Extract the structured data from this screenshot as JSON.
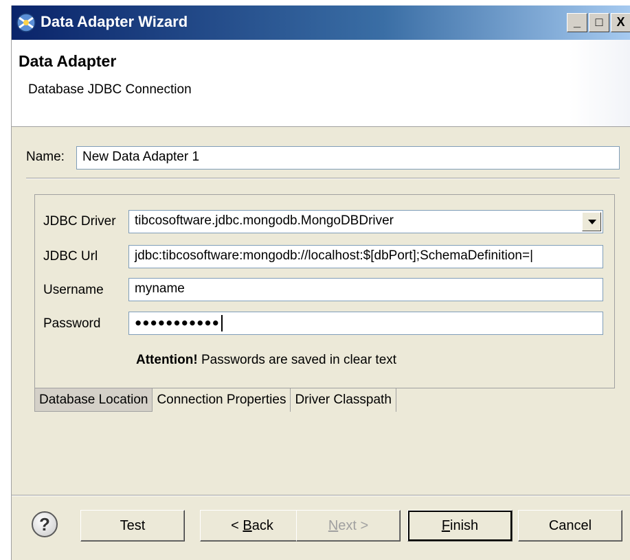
{
  "window": {
    "title": "Data Adapter Wizard",
    "minimize_label": "_",
    "maximize_label": "□",
    "close_label": "X"
  },
  "header": {
    "title": "Data Adapter",
    "description": "Database JDBC Connection"
  },
  "name_field": {
    "label": "Name:",
    "value": "New Data Adapter 1"
  },
  "connection": {
    "driver_label": "JDBC Driver",
    "driver_value": "tibcosoftware.jdbc.mongodb.MongoDBDriver",
    "url_label": "JDBC Url",
    "url_value": "jdbc:tibcosoftware:mongodb://localhost:$[dbPort];SchemaDefinition=|",
    "username_label": "Username",
    "username_value": "myname",
    "password_label": "Password",
    "password_value": "●●●●●●●●●●●",
    "attention_bold": "Attention!",
    "attention_text": " Passwords are saved in clear text"
  },
  "tabs": [
    {
      "label": "Database Location",
      "active": true
    },
    {
      "label": "Connection Properties",
      "active": false
    },
    {
      "label": "Driver Classpath",
      "active": false
    }
  ],
  "buttons": {
    "help": "?",
    "test": "Test",
    "back_prefix": "< ",
    "back_mnemonic": "B",
    "back_rest": "ack",
    "next_mnemonic": "N",
    "next_rest": "ext >",
    "finish_mnemonic": "F",
    "finish_rest": "inish",
    "cancel": "Cancel"
  },
  "colors": {
    "titlebar_start": "#0a246a",
    "dialog_bg": "#ece9d8"
  }
}
